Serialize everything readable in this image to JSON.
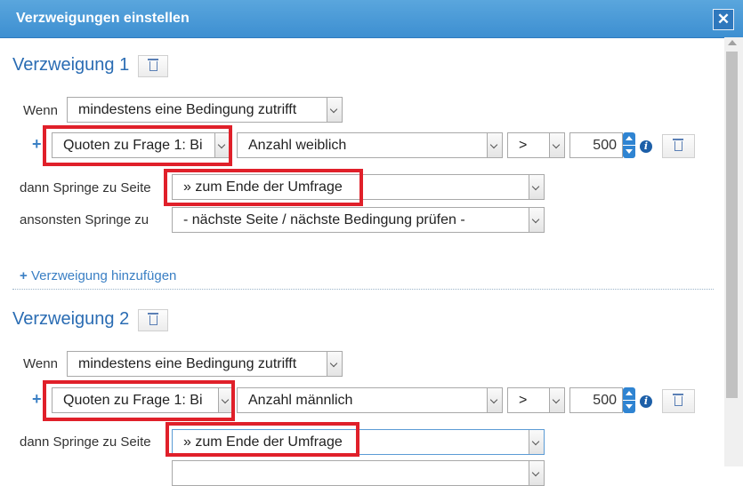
{
  "dialog": {
    "title": "Verzweigungen einstellen",
    "close_glyph": "✕"
  },
  "branches": [
    {
      "heading": "Verzweigung 1",
      "if_label": "Wenn",
      "if_value": "mindestens eine Bedingung zutrifft",
      "condition": {
        "source": "Quoten zu Frage 1: Bi",
        "field": "Anzahl weiblich",
        "operator": ">",
        "number": "500"
      },
      "then_label": "dann Springe zu Seite",
      "then_value": "» zum Ende der Umfrage",
      "else_label": "ansonsten Springe zu",
      "else_value": "- nächste Seite / nächste Bedingung prüfen -"
    },
    {
      "heading": "Verzweigung 2",
      "if_label": "Wenn",
      "if_value": "mindestens eine Bedingung zutrifft",
      "condition": {
        "source": "Quoten zu Frage 1: Bi",
        "field": "Anzahl männlich",
        "operator": ">",
        "number": "500"
      },
      "then_label": "dann Springe zu Seite",
      "then_value": "» zum Ende der Umfrage"
    }
  ],
  "add_branch_label": "Verzweigung hinzufügen",
  "icons": {
    "plus": "+",
    "info": "i"
  },
  "colors": {
    "title_bar": "#3d8fd1",
    "heading": "#2a6cb3",
    "highlight": "#e0202a",
    "link": "#3a7fc4"
  }
}
